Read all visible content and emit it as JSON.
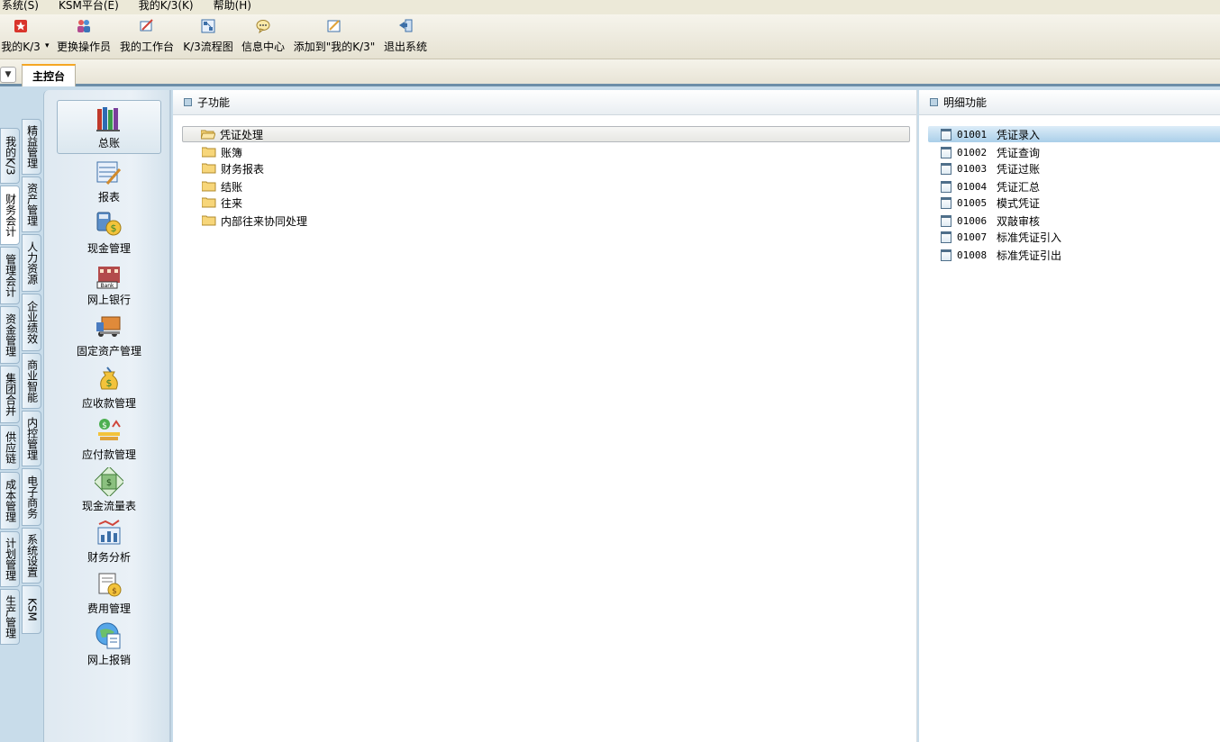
{
  "menubar": {
    "items": [
      "系统(S)",
      "KSM平台(E)",
      "我的K/3(K)",
      "帮助(H)"
    ]
  },
  "toolbar": {
    "items": [
      {
        "label": "我的K/3",
        "icon": "star-icon"
      },
      {
        "label": "更换操作员",
        "icon": "users-icon"
      },
      {
        "label": "我的工作台",
        "icon": "workbench-icon"
      },
      {
        "label": "K/3流程图",
        "icon": "flowchart-icon"
      },
      {
        "label": "信息中心",
        "icon": "message-icon"
      },
      {
        "label": "添加到\"我的K/3\"",
        "icon": "add-favorite-icon"
      },
      {
        "label": "退出系统",
        "icon": "exit-icon"
      }
    ]
  },
  "tabs": {
    "main": "主控台"
  },
  "vtabs_outer": [
    "我的K/3",
    "财务会计",
    "管理会计",
    "资金管理",
    "集团合并",
    "供应链",
    "成本管理",
    "计划管理",
    "生产管理"
  ],
  "vtabs_inner": [
    "精益管理",
    "资产管理",
    "人力资源",
    "企业绩效",
    "商业智能",
    "内控管理",
    "电子商务",
    "系统设置",
    "KSM"
  ],
  "modules": [
    {
      "label": "总账",
      "icon": "ledger-books-icon"
    },
    {
      "label": "报表",
      "icon": "report-icon"
    },
    {
      "label": "现金管理",
      "icon": "cash-management-icon"
    },
    {
      "label": "网上银行",
      "icon": "bank-icon"
    },
    {
      "label": "固定资产管理",
      "icon": "truck-icon"
    },
    {
      "label": "应收款管理",
      "icon": "money-bag-icon"
    },
    {
      "label": "应付款管理",
      "icon": "payable-icon"
    },
    {
      "label": "现金流量表",
      "icon": "cash-flow-icon"
    },
    {
      "label": "财务分析",
      "icon": "analysis-icon"
    },
    {
      "label": "费用管理",
      "icon": "expense-icon"
    },
    {
      "label": "网上报销",
      "icon": "online-expense-icon"
    }
  ],
  "sub_functions": {
    "title": "子功能",
    "items": [
      "凭证处理",
      "账簿",
      "财务报表",
      "结账",
      "往来",
      "内部往来协同处理"
    ]
  },
  "detail_functions": {
    "title": "明细功能",
    "items": [
      {
        "code": "01001",
        "name": "凭证录入"
      },
      {
        "code": "01002",
        "name": "凭证查询"
      },
      {
        "code": "01003",
        "name": "凭证过账"
      },
      {
        "code": "01004",
        "name": "凭证汇总"
      },
      {
        "code": "01005",
        "name": "模式凭证"
      },
      {
        "code": "01006",
        "name": "双敲审核"
      },
      {
        "code": "01007",
        "name": "标准凭证引入"
      },
      {
        "code": "01008",
        "name": "标准凭证引出"
      }
    ]
  },
  "colors": {
    "accent_tab": "#f5a623",
    "selection": "#aacfe9",
    "panel_bg": "#c8dcea"
  }
}
